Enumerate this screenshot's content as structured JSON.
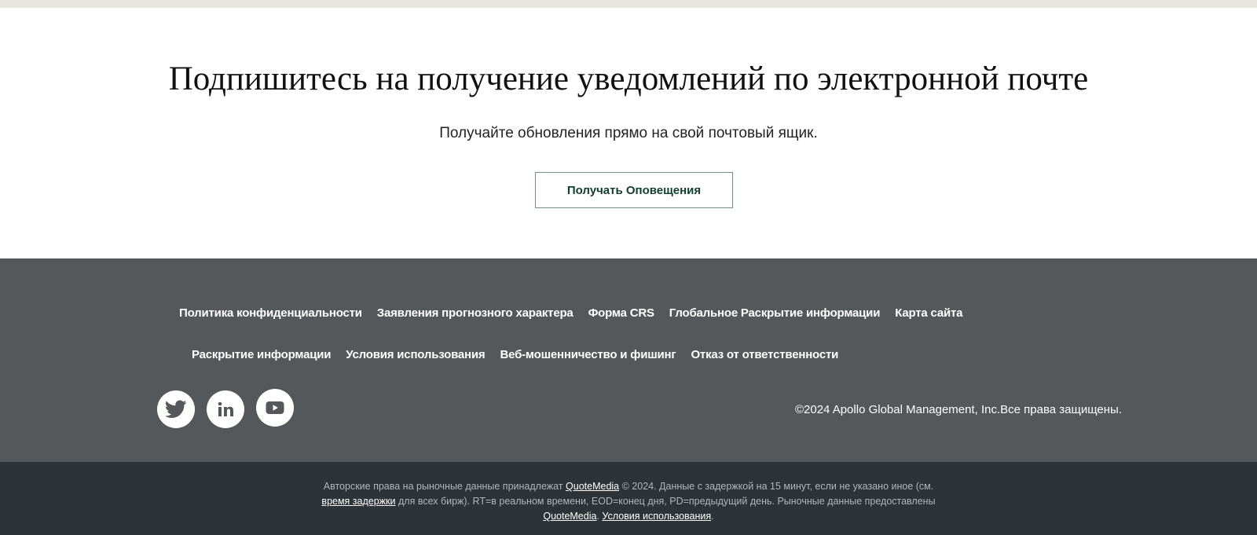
{
  "subscribe": {
    "title": "Подпишитесь на получение уведомлений по электронной почте",
    "subtitle": "Получайте обновления прямо на свой почтовый ящик.",
    "button_label": "Получать Оповещения"
  },
  "footer": {
    "links_row1": [
      "Политика конфиденциальности",
      "Заявления прогнозного характера",
      "Форма CRS",
      "Глобальное Раскрытие информации",
      "Карта сайта"
    ],
    "links_row2": [
      "Раскрытие информации",
      "Условия использования",
      "Веб-мошенничество и фишинг",
      "Отказ от ответственности"
    ],
    "social": [
      "twitter-icon",
      "linkedin-icon",
      "youtube-icon"
    ],
    "copyright": "©2024 Apollo Global Management, Inc.Все права защищены."
  },
  "bottom": {
    "line1_pre": "Авторские права на рыночные данные принадлежат",
    "link_quotemedia": "QuoteMedia",
    "line1_post": "© 2024. Данные с задержкой на 15 минут, если не указано иное (см.",
    "link_delay": "время задержки",
    "line2_post": "для всех бирж). RT=в реальном времени, EOD=конец дня, PD=предыдущий день. Рыночные данные предоставлены",
    "link_quotemedia2": "QuoteMedia",
    "sep": ".",
    "link_terms": "Условия использования",
    "end": "."
  },
  "colors": {
    "top_strip": "#e8e5df",
    "footer_bg": "#54585b",
    "bottom_bg": "#2e3337",
    "button_text": "#0f3d2e",
    "button_border": "#6e8f86"
  }
}
